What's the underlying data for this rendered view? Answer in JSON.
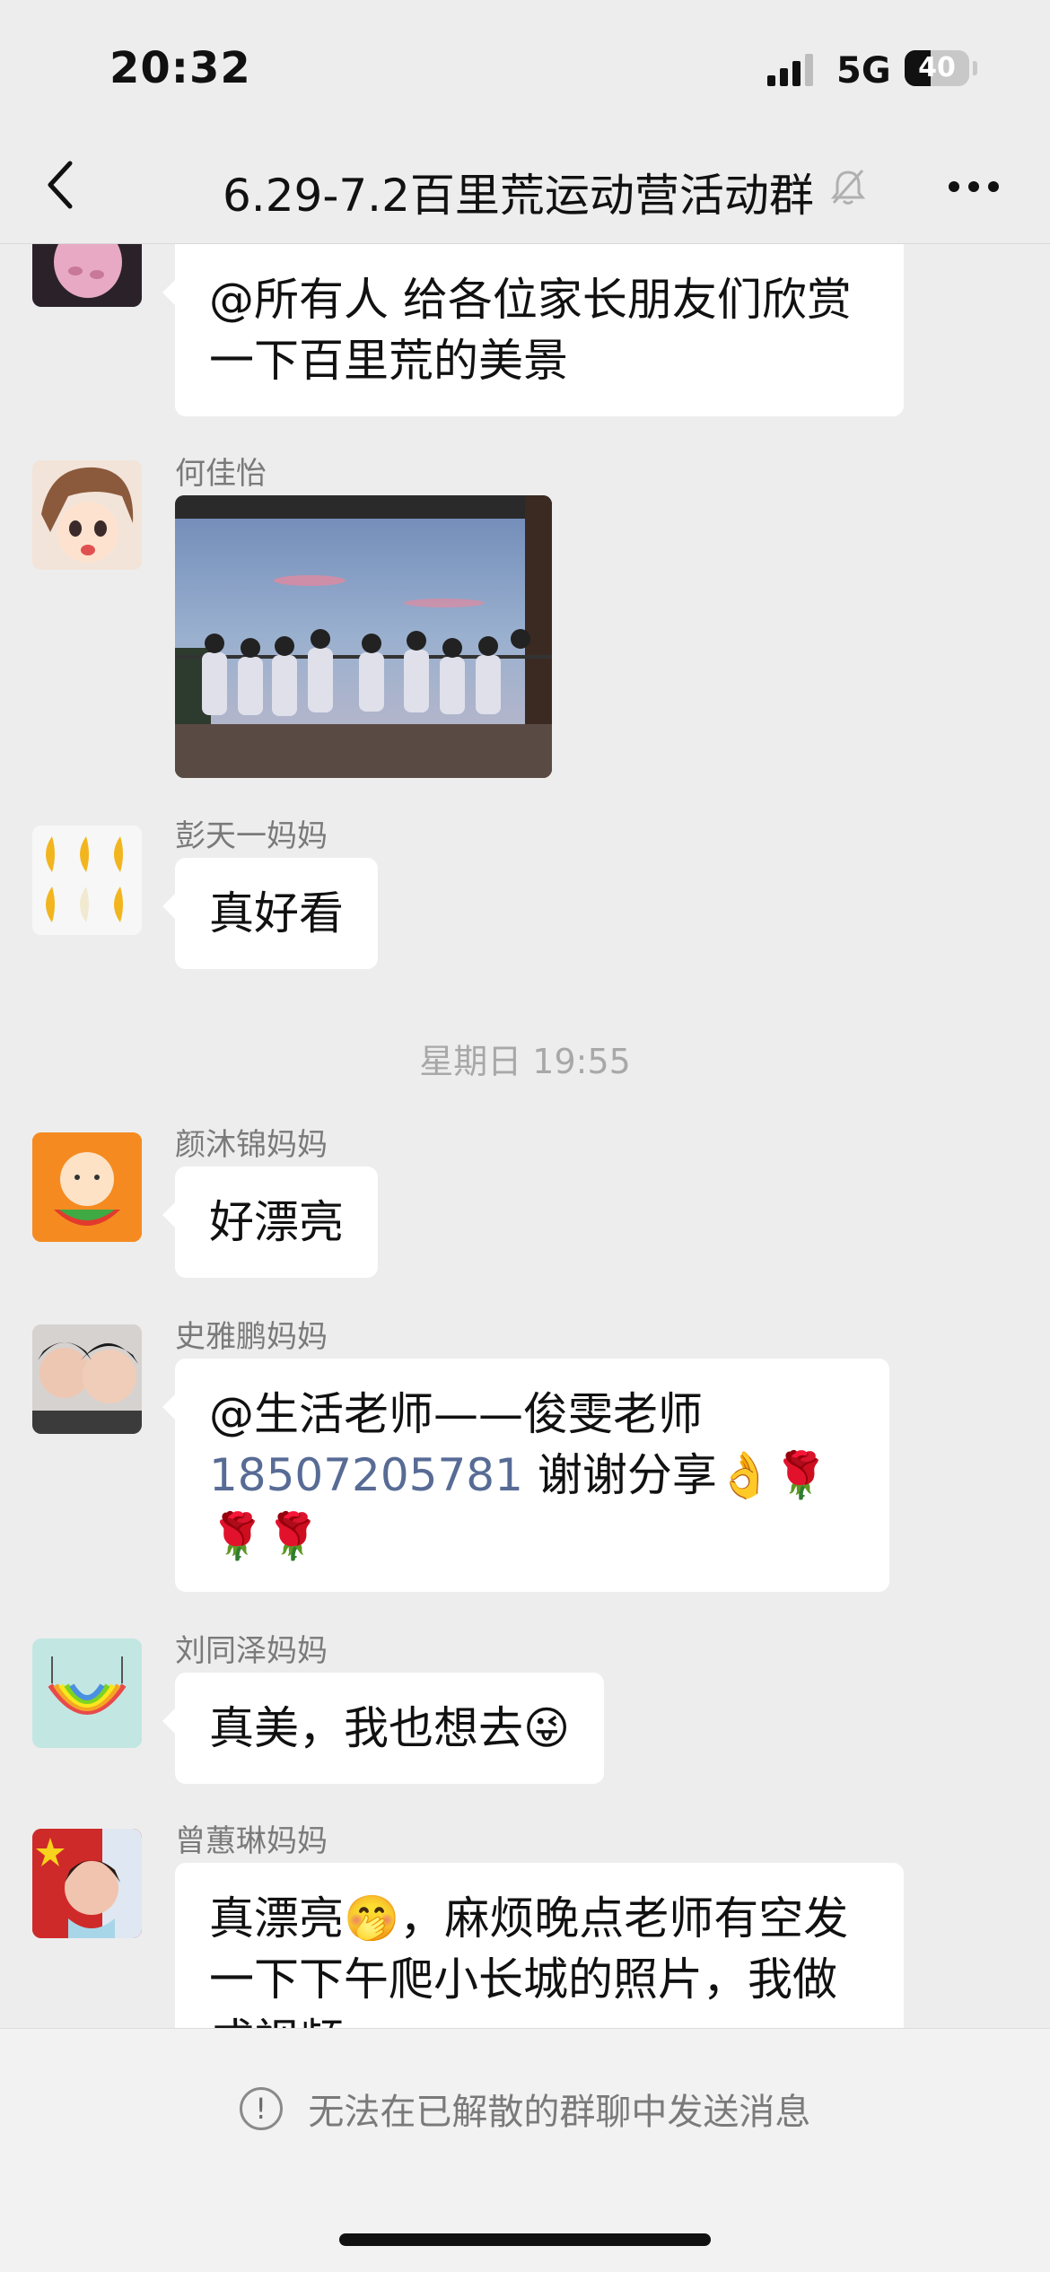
{
  "status_bar": {
    "time": "20:32",
    "network": "5G",
    "battery": "40"
  },
  "nav": {
    "title": "6.29-7.2百里荒运动营活动群"
  },
  "messages": [
    {
      "sender": "",
      "text": "@所有人 给各位家长朋友们欣赏一下百里荒的美景"
    },
    {
      "sender": "何佳怡",
      "type": "image"
    },
    {
      "sender": "彭天一妈妈",
      "text": "真好看"
    },
    {
      "timestamp": "星期日 19:55"
    },
    {
      "sender": "颜沐锦妈妈",
      "text": "好漂亮"
    },
    {
      "sender": "史雅鹏妈妈",
      "text_pre": "@生活老师——俊雯老师",
      "phone": "18507205781",
      "text_post": " 谢谢分享👌🌹🌹🌹"
    },
    {
      "sender": "刘同泽妈妈",
      "text": "真美，我也想去😜"
    },
    {
      "sender": "曾蕙琳妈妈",
      "text": "真漂亮🤭，麻烦晚点老师有空发一下下午爬小长城的照片，我做成视频"
    }
  ],
  "footer": {
    "notice": "无法在已解散的群聊中发送消息"
  },
  "colors": {
    "background": "#ededed",
    "bubble": "#ffffff",
    "link": "#576b95"
  }
}
